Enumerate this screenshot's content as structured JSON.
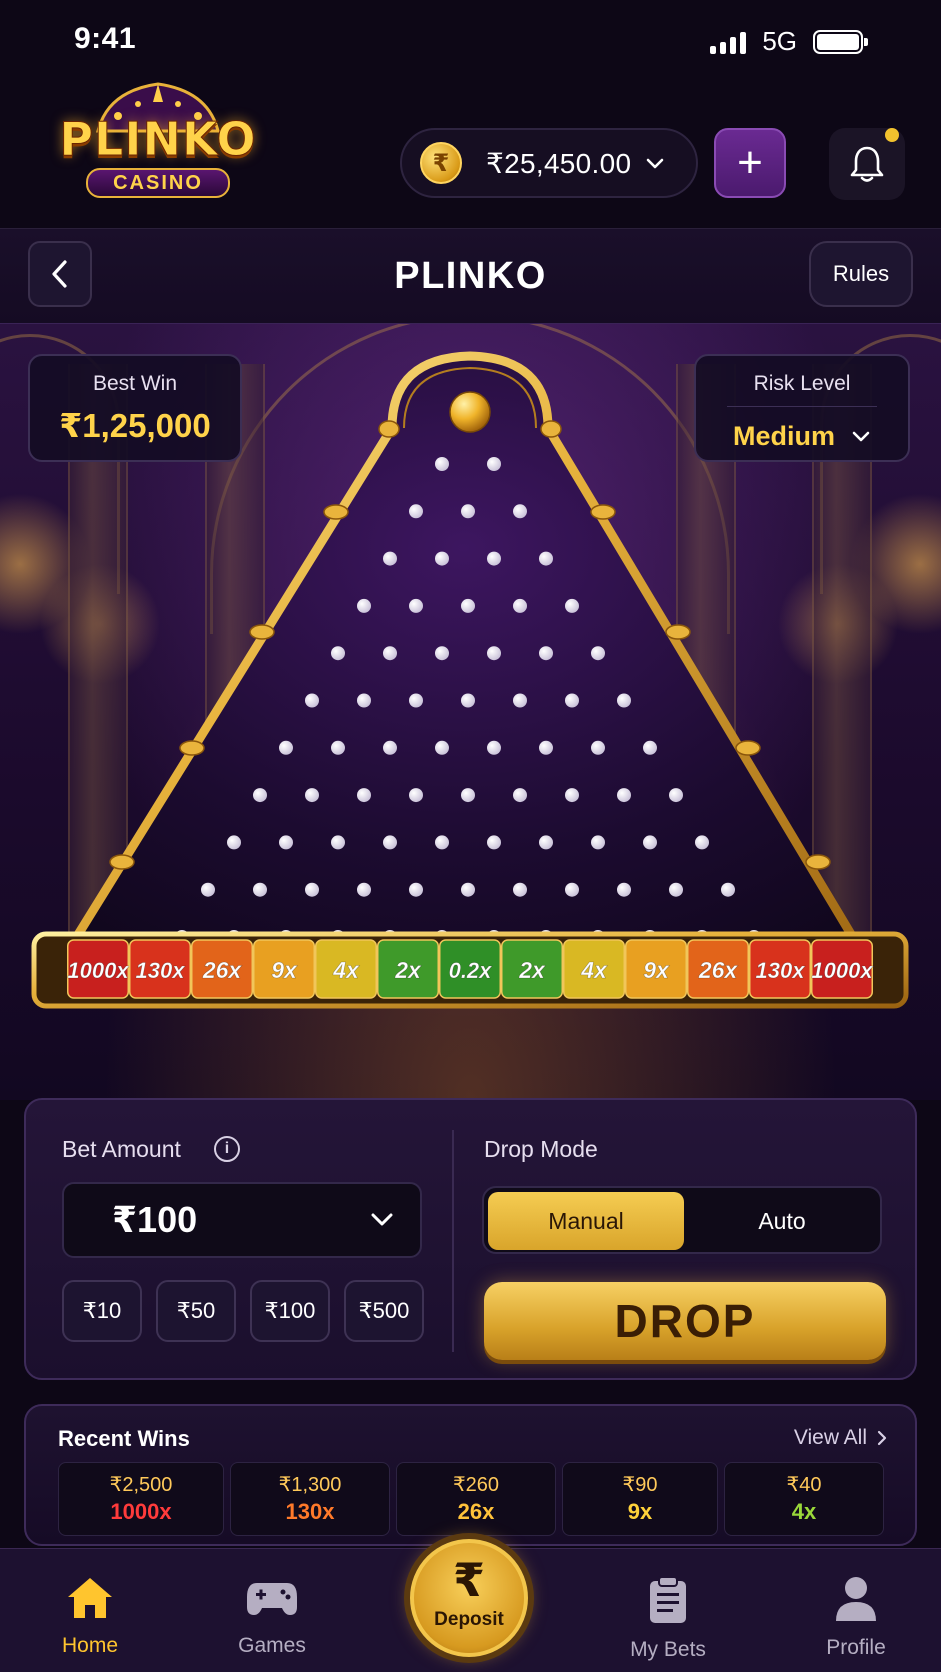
{
  "status": {
    "time": "9:41",
    "network": "5G"
  },
  "header": {
    "logo_title": "PLINKO",
    "logo_subtitle": "CASINO",
    "currency_symbol": "₹",
    "balance": "₹25,450.00",
    "add_label": "+"
  },
  "title_bar": {
    "title": "PLINKO",
    "rules_label": "Rules"
  },
  "stats": {
    "best_win_label": "Best Win",
    "best_win_value": "₹1,25,000",
    "risk_label": "Risk Level",
    "risk_value": "Medium"
  },
  "multipliers": [
    {
      "label": "1000x",
      "color": "#c8201e"
    },
    {
      "label": "130x",
      "color": "#d8321c"
    },
    {
      "label": "26x",
      "color": "#e2641a"
    },
    {
      "label": "9x",
      "color": "#e8a021"
    },
    {
      "label": "4x",
      "color": "#d9b823"
    },
    {
      "label": "2x",
      "color": "#3f9a2a"
    },
    {
      "label": "0.2x",
      "color": "#2f8f27"
    },
    {
      "label": "2x",
      "color": "#3f9a2a"
    },
    {
      "label": "4x",
      "color": "#d9b823"
    },
    {
      "label": "9x",
      "color": "#e8a021"
    },
    {
      "label": "26x",
      "color": "#e2641a"
    },
    {
      "label": "130x",
      "color": "#d8321c"
    },
    {
      "label": "1000x",
      "color": "#c8201e"
    }
  ],
  "bet": {
    "label": "Bet Amount",
    "info_icon": "i",
    "value": "₹100",
    "chips": [
      "₹10",
      "₹50",
      "₹100",
      "₹500"
    ]
  },
  "drop": {
    "mode_label": "Drop Mode",
    "modes": [
      "Manual",
      "Auto"
    ],
    "active_mode": "Manual",
    "button_label": "DROP"
  },
  "recent": {
    "title": "Recent Wins",
    "view_all": "View All",
    "wins": [
      {
        "amount": "₹2,500",
        "mult": "1000x",
        "color": "#ff3b3b"
      },
      {
        "amount": "₹1,300",
        "mult": "130x",
        "color": "#ff7a2a"
      },
      {
        "amount": "₹260",
        "mult": "26x",
        "color": "#ffc23a"
      },
      {
        "amount": "₹90",
        "mult": "9x",
        "color": "#ffd23a"
      },
      {
        "amount": "₹40",
        "mult": "4x",
        "color": "#9ad83a"
      }
    ]
  },
  "nav": {
    "home": "Home",
    "games": "Games",
    "deposit_symbol": "₹",
    "deposit": "Deposit",
    "bets": "My Bets",
    "profile": "Profile",
    "active": "Home"
  },
  "colors": {
    "accent_gold": "#ffd34a",
    "purple": "#4b1a6e",
    "background": "#0d0716"
  }
}
